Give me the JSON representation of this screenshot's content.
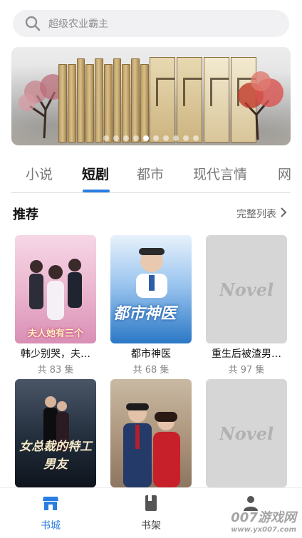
{
  "search": {
    "placeholder": "超级农业霸主",
    "icon": "search-icon"
  },
  "banner": {
    "page_count": 10,
    "active_index": 4
  },
  "tabs": [
    {
      "label": "小说",
      "active": false
    },
    {
      "label": "短剧",
      "active": true
    },
    {
      "label": "都市",
      "active": false
    },
    {
      "label": "现代言情",
      "active": false
    },
    {
      "label": "网",
      "active": false
    }
  ],
  "section": {
    "title": "推荐",
    "more_label": "完整列表"
  },
  "cards": [
    {
      "title": "韩少别哭，夫…",
      "count": "共 83 集",
      "cover_caption": "夫人她有三个"
    },
    {
      "title": "都市神医",
      "count": "共 68 集",
      "cover_caption": "都市神医"
    },
    {
      "title": "重生后被渣男…",
      "count": "共 97 集",
      "cover_caption": "Novel"
    },
    {
      "title": "",
      "count": "",
      "cover_caption": "女总裁的特工男友"
    },
    {
      "title": "",
      "count": "",
      "cover_caption": ""
    },
    {
      "title": "",
      "count": "",
      "cover_caption": "Novel"
    }
  ],
  "nav": [
    {
      "label": "书城",
      "icon": "store-icon",
      "active": true
    },
    {
      "label": "书架",
      "icon": "bookshelf-icon",
      "active": false
    },
    {
      "label": "",
      "icon": "profile-icon",
      "active": false
    }
  ],
  "watermark": {
    "main": "007游戏网",
    "sub": "www.yx007.com"
  },
  "colors": {
    "accent": "#2a7de1",
    "search_bg": "#f1f1f3",
    "placeholder_cover": "#d6d6d6"
  }
}
